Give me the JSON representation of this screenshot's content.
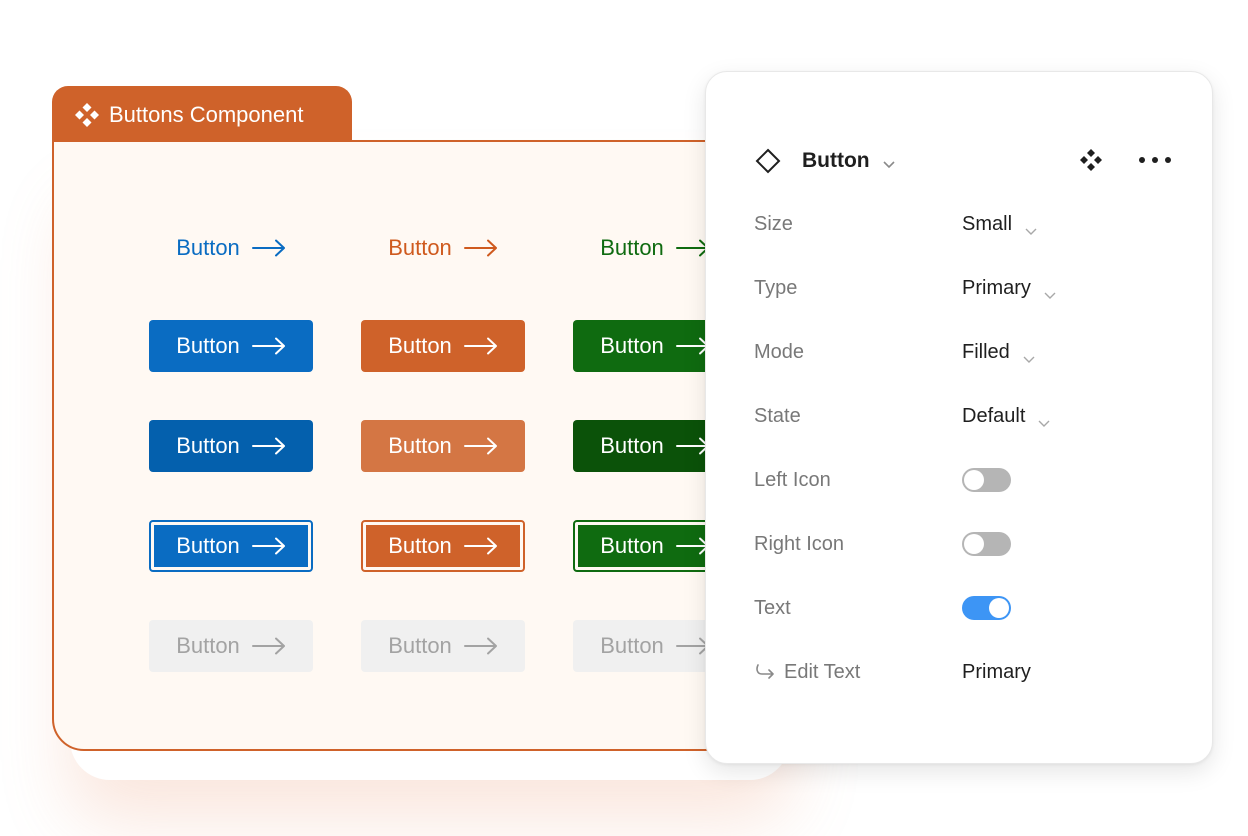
{
  "component_frame": {
    "title": "Buttons Component",
    "accent_color": "#cf622a",
    "background_color": "#fff9f3",
    "columns": [
      {
        "name": "blue",
        "color": "#0a6cc2"
      },
      {
        "name": "orange",
        "color": "#cf622a"
      },
      {
        "name": "green",
        "color": "#0f6b10"
      }
    ],
    "rows": [
      {
        "variant": "link",
        "buttons": [
          {
            "label": "Button",
            "text_color": "#0a6cc2",
            "bg": "transparent"
          },
          {
            "label": "Button",
            "text_color": "#cf5a1e",
            "bg": "transparent"
          },
          {
            "label": "Button",
            "text_color": "#0f6b10",
            "bg": "transparent"
          }
        ]
      },
      {
        "variant": "filled-default",
        "buttons": [
          {
            "label": "Button",
            "text_color": "#ffffff",
            "bg": "#0a6cc2"
          },
          {
            "label": "Button",
            "text_color": "#ffffff",
            "bg": "#cf622a"
          },
          {
            "label": "Button",
            "text_color": "#ffffff",
            "bg": "#0f6b10"
          }
        ]
      },
      {
        "variant": "filled-hover",
        "buttons": [
          {
            "label": "Button",
            "text_color": "#ffffff",
            "bg": "#0460ad"
          },
          {
            "label": "Button",
            "text_color": "#ffffff",
            "bg": "#d47644"
          },
          {
            "label": "Button",
            "text_color": "#ffffff",
            "bg": "#0b5209"
          }
        ]
      },
      {
        "variant": "filled-focus",
        "buttons": [
          {
            "label": "Button",
            "text_color": "#ffffff",
            "bg": "#0a6cc2"
          },
          {
            "label": "Button",
            "text_color": "#ffffff",
            "bg": "#cf622a"
          },
          {
            "label": "Button",
            "text_color": "#ffffff",
            "bg": "#0f6b10"
          }
        ]
      },
      {
        "variant": "disabled",
        "buttons": [
          {
            "label": "Button",
            "text_color": "#a3a3a3",
            "bg": "#f0f0f0"
          },
          {
            "label": "Button",
            "text_color": "#a3a3a3",
            "bg": "#f0f0f0"
          },
          {
            "label": "Button",
            "text_color": "#a3a3a3",
            "bg": "#f0f0f0"
          }
        ]
      }
    ],
    "button_icon": "arrow-right-icon"
  },
  "properties_panel": {
    "header": {
      "icon": "component-diamond-icon",
      "title": "Button",
      "actions": [
        "component-instance-icon",
        "more-options-icon"
      ]
    },
    "properties": [
      {
        "label": "Size",
        "type": "dropdown",
        "value": "Small"
      },
      {
        "label": "Type",
        "type": "dropdown",
        "value": "Primary"
      },
      {
        "label": "Mode",
        "type": "dropdown",
        "value": "Filled"
      },
      {
        "label": "State",
        "type": "dropdown",
        "value": "Default"
      },
      {
        "label": "Left Icon",
        "type": "toggle",
        "value": false
      },
      {
        "label": "Right Icon",
        "type": "toggle",
        "value": false
      },
      {
        "label": "Text",
        "type": "toggle",
        "value": true
      },
      {
        "label": "Edit Text",
        "type": "text",
        "value": "Primary",
        "icon": "return-arrow-icon"
      }
    ],
    "toggle_on_color": "#3d95f5",
    "toggle_off_color": "#b5b5b5"
  }
}
